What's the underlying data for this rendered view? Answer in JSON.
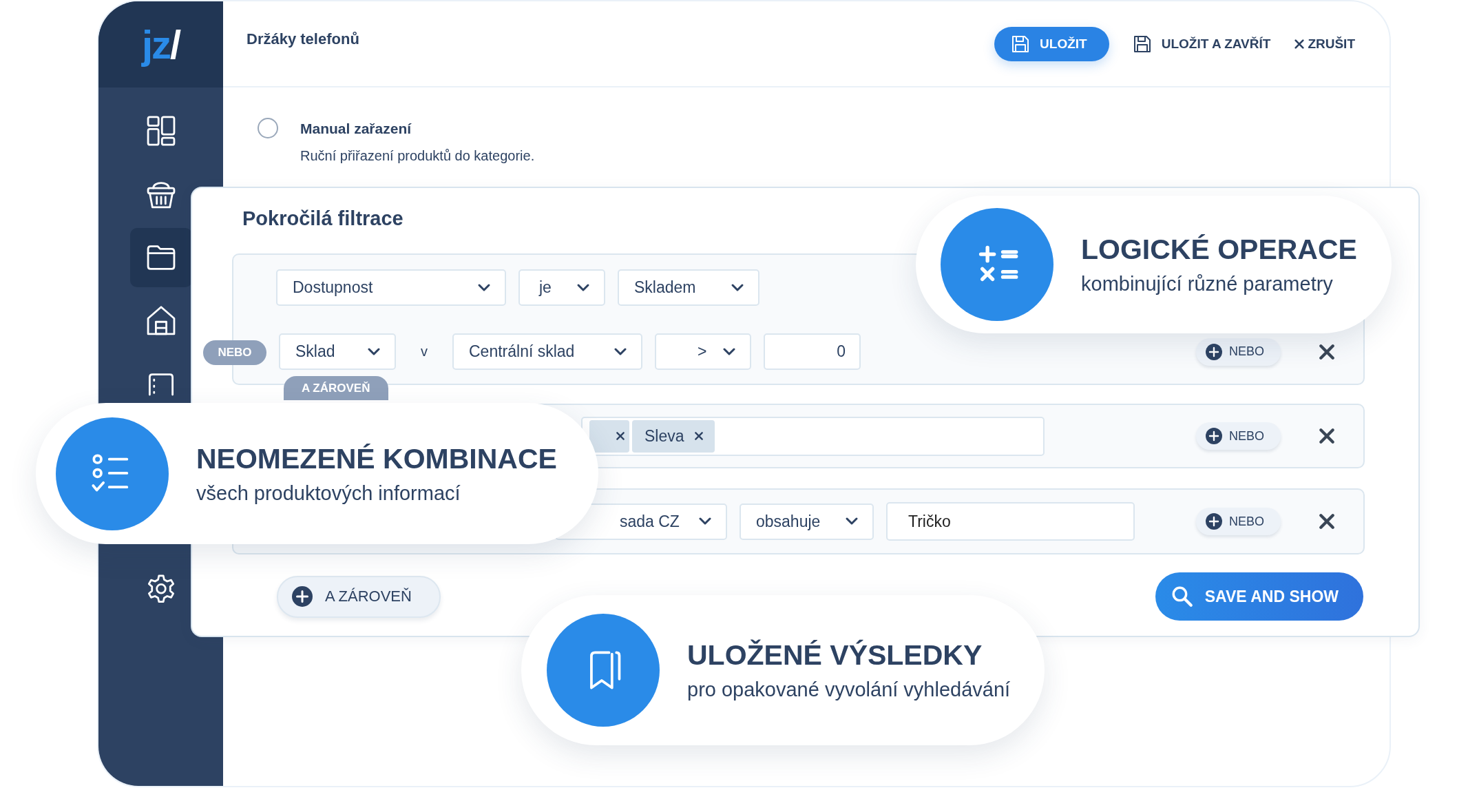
{
  "logo": {
    "letters": "jz",
    "slash": "/"
  },
  "sidebar": {
    "items": [
      {
        "kind": "dashboard",
        "selected": false
      },
      {
        "kind": "basket",
        "selected": false
      },
      {
        "kind": "folder",
        "selected": true
      },
      {
        "kind": "store",
        "selected": false
      },
      {
        "kind": "book",
        "selected": false
      },
      {
        "kind": "settings",
        "selected": false
      }
    ]
  },
  "header": {
    "title": "Držáky telefonů",
    "actions": [
      {
        "kind": "primary",
        "label": "ULOŽIT"
      },
      {
        "kind": "save",
        "label": "ULOŽIT A ZAVŘÍT"
      },
      {
        "kind": "cancel",
        "label": "ZRUŠIT"
      }
    ]
  },
  "manual_option": {
    "selected": false,
    "title": "Manual zařazení",
    "description": "Ruční přiřazení produktů do kategorie."
  },
  "filter_panel": {
    "title": "Pokročilá filtrace",
    "groups": [
      {
        "and_badge": "A ZÁROVEŇ",
        "or_button": "NEBO",
        "rows": [
          {
            "items": [
              {
                "kind": "select",
                "value": "Dostupnost"
              },
              {
                "kind": "select",
                "value": "je"
              },
              {
                "kind": "select",
                "value": "Skladem"
              }
            ]
          },
          {
            "connector": "NEBO",
            "items": [
              {
                "kind": "select",
                "value": "Sklad"
              },
              {
                "kind": "text",
                "value": "v"
              },
              {
                "kind": "select",
                "value": "Centrální sklad"
              },
              {
                "kind": "select",
                "value": ">"
              },
              {
                "kind": "input",
                "value": "0"
              }
            ]
          }
        ]
      },
      {
        "or_button": "NEBO",
        "rows": [
          {
            "items": [
              {
                "kind": "tags",
                "tags": [
                  {
                    "covered": true
                  },
                  {
                    "covered": false,
                    "label": "Sleva"
                  }
                ]
              }
            ]
          }
        ]
      },
      {
        "or_button": "NEBO",
        "rows": [
          {
            "items": [
              {
                "kind": "select",
                "value": "sada CZ"
              },
              {
                "kind": "select",
                "value": "obsahuje"
              },
              {
                "kind": "input",
                "value": "Tričko"
              }
            ]
          }
        ]
      }
    ],
    "add_button": "A ZÁROVEŇ",
    "submit_button": "SAVE AND SHOW"
  },
  "callouts": [
    {
      "kind": "operations",
      "title": "LOGICKÉ OPERACE",
      "subtitle": "kombinující různé parametry"
    },
    {
      "kind": "combinations",
      "title": "NEOMEZENÉ KOMBINACE",
      "subtitle": "všech produktových informací"
    },
    {
      "kind": "saved",
      "title": "ULOŽENÉ VÝSLEDKY",
      "subtitle": "pro opakované vyvolání vyhledávání"
    }
  ]
}
